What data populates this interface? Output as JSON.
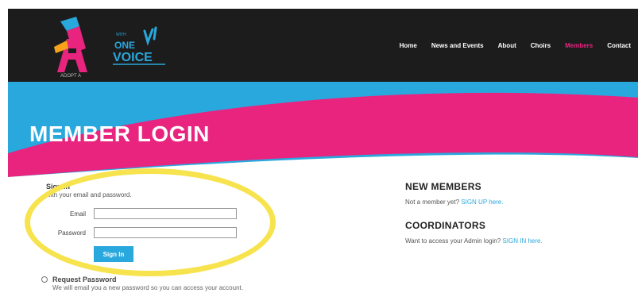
{
  "header": {
    "logo_alt": "SA",
    "logo_sub": "ADOPT A",
    "voice_logo": [
      "WITH",
      "ONE",
      "VOICE"
    ],
    "nav": [
      {
        "label": "Home",
        "active": false
      },
      {
        "label": "News and Events",
        "active": false
      },
      {
        "label": "About",
        "active": false
      },
      {
        "label": "Choirs",
        "active": false
      },
      {
        "label": "Members",
        "active": true
      },
      {
        "label": "Contact",
        "active": false
      }
    ]
  },
  "banner": {
    "title": "MEMBER LOGIN",
    "colors": {
      "blue": "#29a8dd",
      "pink": "#e8247f"
    }
  },
  "signin": {
    "title": "Sign In",
    "subtitle": "with your email and password.",
    "email_label": "Email",
    "email_value": "",
    "password_label": "Password",
    "password_value": "",
    "button_label": "Sign In"
  },
  "request": {
    "title": "Request Password",
    "description": "We will email you a new password so you can access your account."
  },
  "new_members": {
    "heading": "NEW MEMBERS",
    "text": "Not a member yet?",
    "link": "SIGN UP here."
  },
  "coordinators": {
    "heading": "COORDINATORS",
    "text": "Want to access your Admin login?",
    "link": "SIGN IN here."
  },
  "annotation": {
    "color": "#f7e34e"
  }
}
